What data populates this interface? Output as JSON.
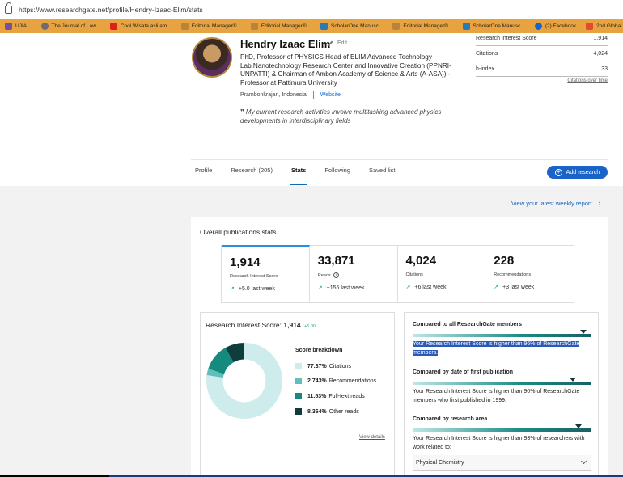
{
  "browser": {
    "url": "https://www.researchgate.net/profile/Hendry-Izaac-Elim/stats"
  },
  "bookmarks": [
    {
      "label": "UJIA...",
      "color": "#7a4e9c"
    },
    {
      "label": "The Journal of Law...",
      "color": "#6d6d6d"
    },
    {
      "label": "Cool Wisata asli am...",
      "color": "#e02020"
    },
    {
      "label": "Editorial Manager®...",
      "color": "#b8833a"
    },
    {
      "label": "Editorial Manager®...",
      "color": "#b8833a"
    },
    {
      "label": "ScholarOne Manusc...",
      "color": "#2a7ab8"
    },
    {
      "label": "Editorial Manager®...",
      "color": "#b8833a"
    },
    {
      "label": "ScholarOne Manusc...",
      "color": "#2a7ab8"
    },
    {
      "label": "(2) Facebook",
      "color": "#1a64c8"
    },
    {
      "label": "2nd Global",
      "color": "#e64a2e"
    }
  ],
  "profile": {
    "name": "Hendry Izaac Elim",
    "edit_label": "Edit",
    "description": "PhD, Professor of PHYSICS Head of ELIM Advanced Technology Lab.Nanotechnology Research Center and Innovative Creation (PPNRI-UNPATTI) & Chairman of Ambon Academy of Science & Arts (A-ASA)) - Professor at Pattimura University",
    "location": "Prambonkrajan, Indonesia",
    "website": "Website",
    "quote": "My current research activities involve multitasking advanced physics developments in interdisciplinary fields"
  },
  "metrics": {
    "ris_label": "Research Interest Score",
    "ris_value": "1,914",
    "citations_label": "Citations",
    "citations_value": "4,024",
    "hindex_label": "h-index",
    "hindex_value": "33",
    "citations_over_time": "Citations over time"
  },
  "tabs": [
    "Profile",
    "Research (205)",
    "Stats",
    "Following",
    "Saved list"
  ],
  "add_research": "Add research",
  "weekly_report": "View your latest weekly report",
  "overall_title": "Overall publications stats",
  "stats": [
    {
      "value": "1,914",
      "label": "Research Interest Score",
      "change": "+5.0 last week"
    },
    {
      "value": "33,871",
      "label": "Reads",
      "change": "+155 last week"
    },
    {
      "value": "4,024",
      "label": "Citations",
      "change": "+6 last week"
    },
    {
      "value": "228",
      "label": "Recommendations",
      "change": "+3 last week"
    }
  ],
  "ris_panel": {
    "title_prefix": "Research Interest Score:",
    "title_value": "1,914",
    "title_change": "+5.00",
    "breakdown_title": "Score breakdown",
    "breakdown": [
      {
        "pct": "77.37%",
        "label": "Citations",
        "value": 77.37,
        "color": "#cdeceb"
      },
      {
        "pct": "2.743%",
        "label": "Recommendations",
        "value": 2.743,
        "color": "#5fc0b9"
      },
      {
        "pct": "11.53%",
        "label": "Full-text reads",
        "value": 11.53,
        "color": "#178a80"
      },
      {
        "pct": "8.364%",
        "label": "Other reads",
        "value": 8.364,
        "color": "#0f3d3e"
      }
    ],
    "view_details": "View details"
  },
  "comparisons": [
    {
      "title": "Compared to all ResearchGate members",
      "text": "Your Research Interest Score is higher than 96% of ResearchGate members.",
      "percent": 96
    },
    {
      "title": "Compared by date of first publication",
      "text": "Your Research Interest Score is higher than 90% of ResearchGate members who first published in 1999.",
      "percent": 90
    },
    {
      "title": "Compared by research area",
      "text": "Your Research Interest Score is higher than 93% of researchers with work related to:",
      "percent": 93
    }
  ],
  "research_area_select": "Physical Chemistry"
}
